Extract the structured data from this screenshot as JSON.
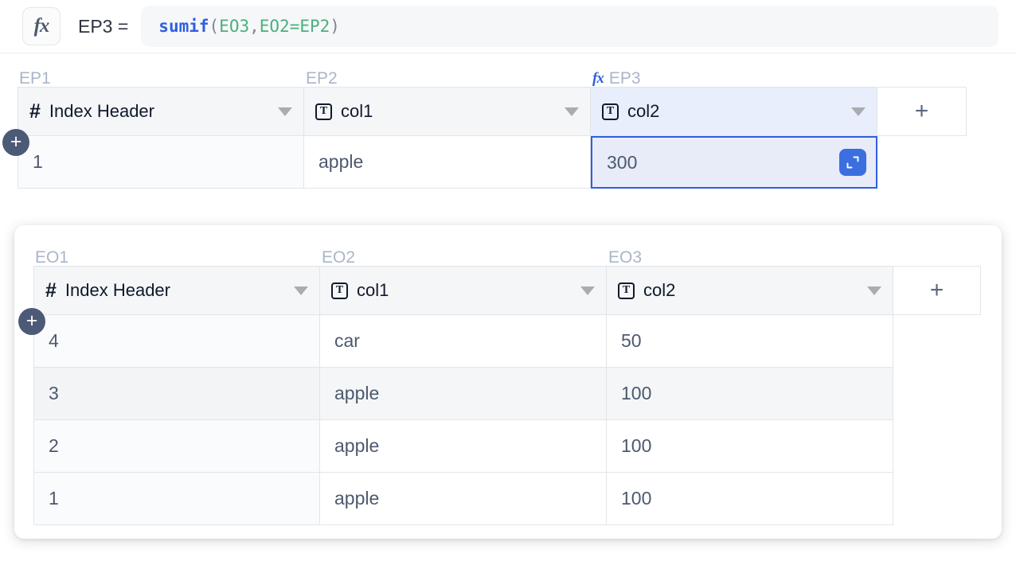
{
  "formula_bar": {
    "fx_icon": "fx-icon",
    "target": "EP3 =",
    "formula_text": "sumif(EO3,EO2=EP2)",
    "tokens": [
      {
        "text": "sumif",
        "kind": "fn"
      },
      {
        "text": "(",
        "kind": "punc"
      },
      {
        "text": "EO3",
        "kind": "ref"
      },
      {
        "text": ",",
        "kind": "punc"
      },
      {
        "text": "EO2=EP2",
        "kind": "ref"
      },
      {
        "text": ")",
        "kind": "punc"
      }
    ]
  },
  "primary_table": {
    "column_labels": [
      {
        "text": "EP1",
        "has_fx": false
      },
      {
        "text": "EP2",
        "has_fx": false
      },
      {
        "text": "EP3",
        "has_fx": true
      }
    ],
    "headers": [
      {
        "icon": "hash-icon",
        "label": "Index Header",
        "selected": false
      },
      {
        "icon": "text-type-icon",
        "label": "col1",
        "selected": false
      },
      {
        "icon": "text-type-icon",
        "label": "col2",
        "selected": true
      }
    ],
    "add_column_label": "+",
    "add_row_label": "+",
    "rows": [
      {
        "index": "1",
        "col1": "apple",
        "col2": "300",
        "striped": false
      }
    ],
    "selected_cell": {
      "row": "1",
      "column": "col2",
      "value": "300",
      "expand_icon": "expand-icon"
    }
  },
  "source_table": {
    "column_labels": [
      {
        "text": "EO1",
        "has_fx": false
      },
      {
        "text": "EO2",
        "has_fx": false
      },
      {
        "text": "EO3",
        "has_fx": false
      }
    ],
    "headers": [
      {
        "icon": "hash-icon",
        "label": "Index Header"
      },
      {
        "icon": "text-type-icon",
        "label": "col1"
      },
      {
        "icon": "text-type-icon",
        "label": "col2"
      }
    ],
    "add_column_label": "+",
    "add_row_label": "+",
    "rows": [
      {
        "index": "4",
        "col1": "car",
        "col2": "50",
        "striped": false
      },
      {
        "index": "3",
        "col1": "apple",
        "col2": "100",
        "striped": true
      },
      {
        "index": "2",
        "col1": "apple",
        "col2": "100",
        "striped": false
      },
      {
        "index": "1",
        "col1": "apple",
        "col2": "100",
        "striped": false
      }
    ]
  },
  "colors": {
    "accent_blue": "#2f5fe0",
    "selection_fill": "#e8ecf9",
    "label_gray": "#a9b6c9",
    "header_bg": "#f4f6f8",
    "text_dark": "#10192b",
    "cell_text": "#4c596e",
    "ref_green": "#4caf7d",
    "handle_slate": "#4c5a77"
  }
}
